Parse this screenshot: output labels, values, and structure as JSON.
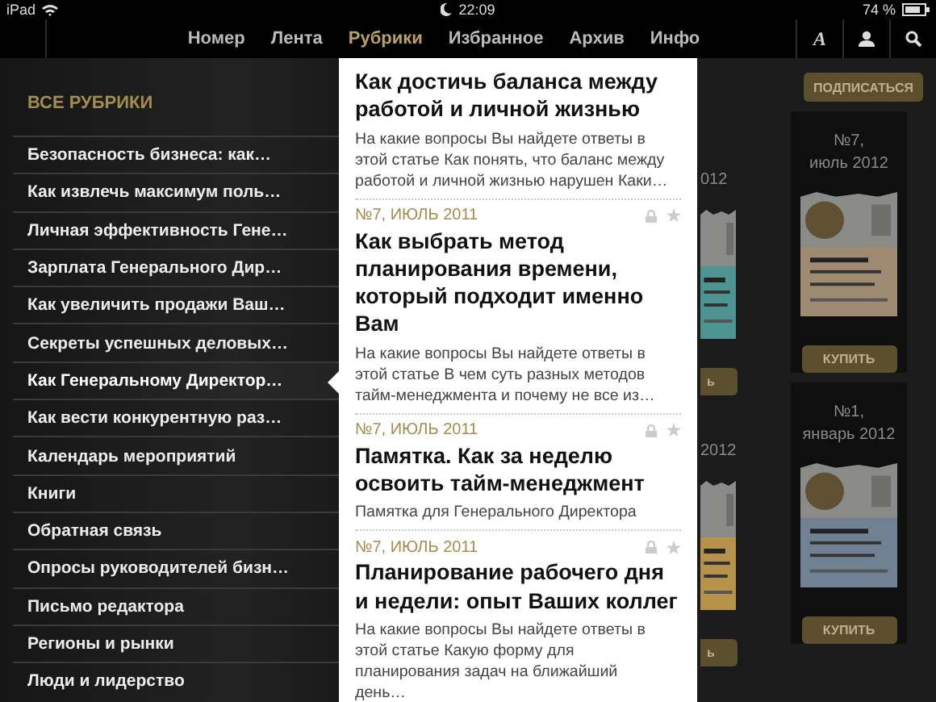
{
  "status_bar": {
    "device": "iPad",
    "time": "22:09",
    "battery": "74 %"
  },
  "nav": {
    "tabs": [
      {
        "label": "Номер",
        "selected": false
      },
      {
        "label": "Лента",
        "selected": false
      },
      {
        "label": "Рубрики",
        "selected": true
      },
      {
        "label": "Избранное",
        "selected": false
      },
      {
        "label": "Архив",
        "selected": false
      },
      {
        "label": "Инфо",
        "selected": false
      }
    ],
    "font_button": "A"
  },
  "sidebar": {
    "heading": "ВСЕ РУБРИКИ",
    "items": [
      {
        "label": "Безопасность бизнеса: как…",
        "selected": false
      },
      {
        "label": "Как извлечь максимум поль…",
        "selected": false
      },
      {
        "label": "Личная эффективность Гене…",
        "selected": false
      },
      {
        "label": "Зарплата Генерального Дир…",
        "selected": false
      },
      {
        "label": "Как увеличить продажи Ваш…",
        "selected": false
      },
      {
        "label": "Секреты успешных деловых…",
        "selected": false
      },
      {
        "label": "Как Генеральному Директор…",
        "selected": true
      },
      {
        "label": "Как вести конкурентную раз…",
        "selected": false
      },
      {
        "label": "Календарь мероприятий",
        "selected": false
      },
      {
        "label": "Книги",
        "selected": false
      },
      {
        "label": "Обратная связь",
        "selected": false
      },
      {
        "label": "Опросы руководителей бизн…",
        "selected": false
      },
      {
        "label": "Письмо редактора",
        "selected": false
      },
      {
        "label": "Регионы и рынки",
        "selected": false
      },
      {
        "label": "Люди и лидерство",
        "selected": false
      }
    ]
  },
  "articles": [
    {
      "title": "Как достичь баланса между работой и личной жизнью",
      "excerpt": "На какие вопросы Вы найдете ответы в этой статье Как понять, что баланс между работой и личной жизнью нарушен Каки…"
    },
    {
      "date": "№7, ИЮЛЬ 2011",
      "title": "Как выбрать метод планирования времени, который подходит именно Вам",
      "excerpt": "На какие вопросы Вы найдете ответы в этой статье В чем суть разных методов тайм-менеджмента и почему не все из…"
    },
    {
      "date": "№7, ИЮЛЬ 2011",
      "title": "Памятка. Как за неделю освоить тайм-менеджмент",
      "excerpt": "Памятка для Генерального Директора"
    },
    {
      "date": "№7, ИЮЛЬ 2011",
      "title": "Планирование рабочего дня и недели: опыт Ваших коллег",
      "excerpt": "На какие вопросы Вы найдете ответы в этой статье Какую форму для планирования задач на ближайший день…"
    }
  ],
  "store": {
    "subscribe": "ПОДПИСАТЬСЯ",
    "partial_issues": [
      {
        "date": "012",
        "buy": "ь"
      },
      {
        "date": "2012",
        "buy": "ь"
      }
    ],
    "issues": [
      {
        "number": "№7,",
        "date": "июль 2012",
        "buy": "КУПИТЬ"
      },
      {
        "number": "№1,",
        "date": "январь 2012",
        "buy": "КУПИТЬ"
      }
    ]
  }
}
